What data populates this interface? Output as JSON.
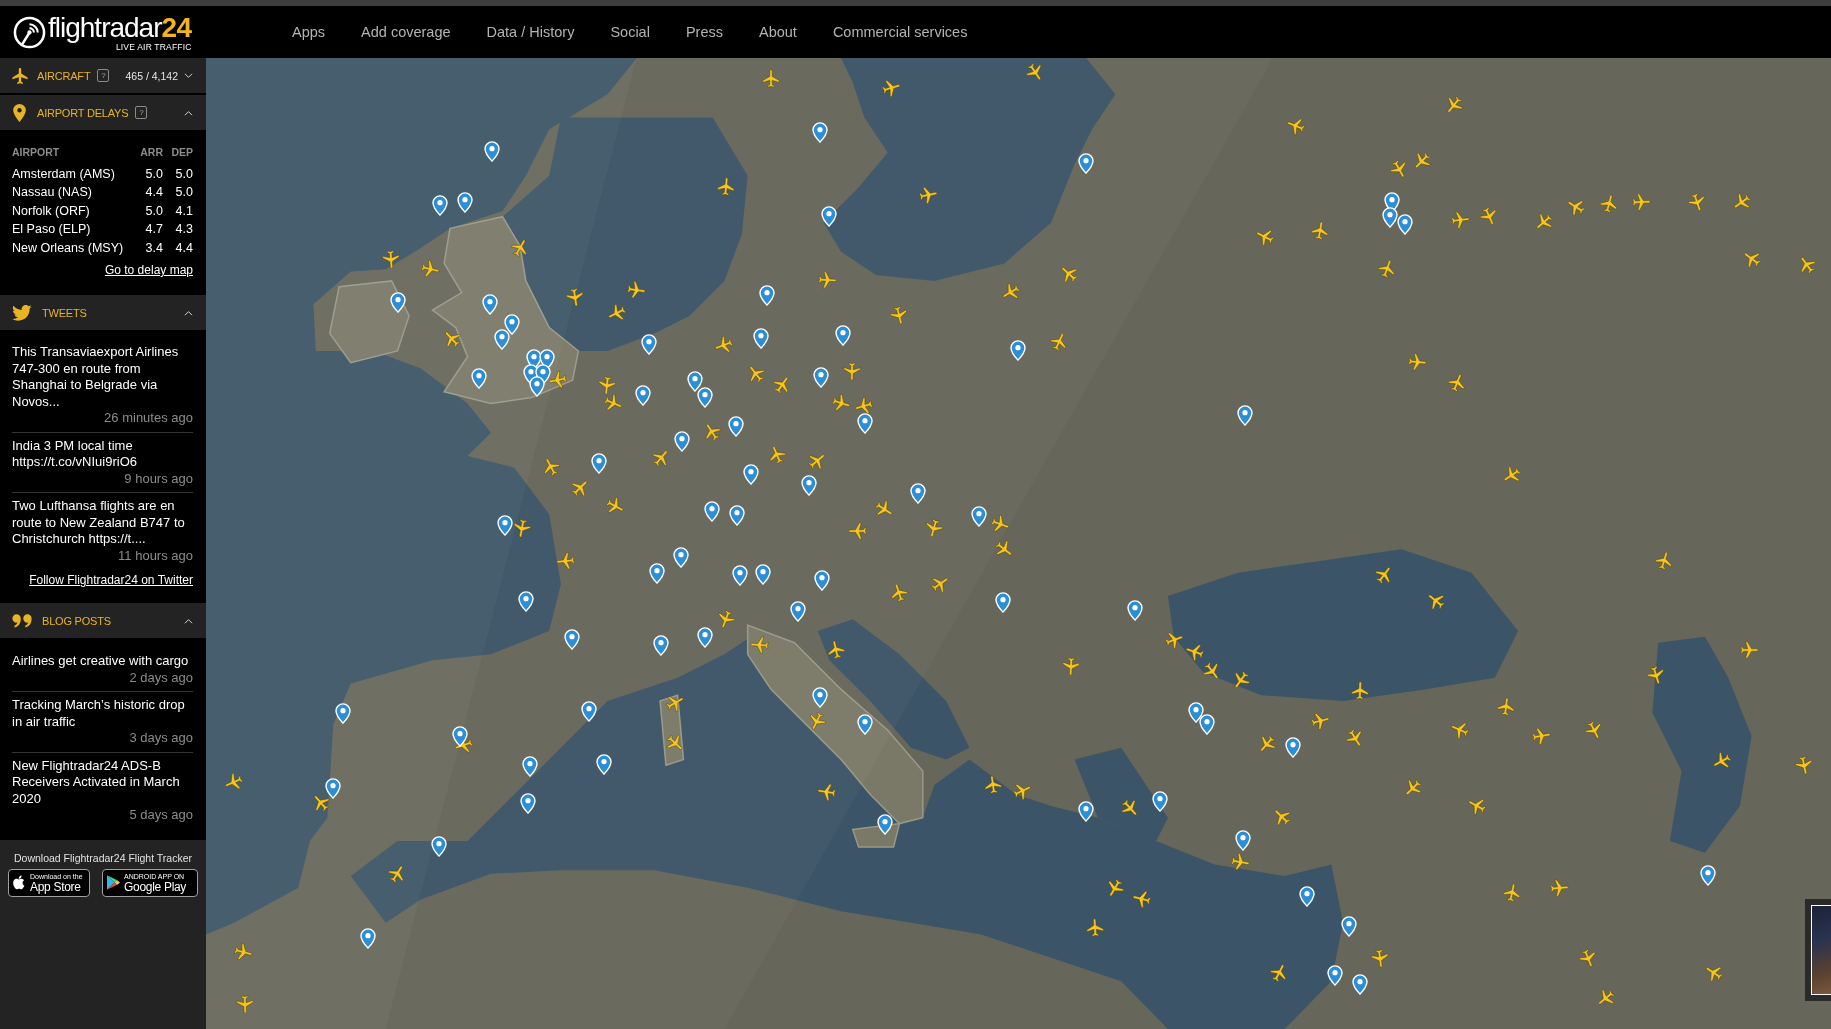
{
  "header": {
    "logo": {
      "name": "flightradar",
      "number": "24",
      "tagline": "LIVE AIR TRAFFIC"
    },
    "nav": [
      "Apps",
      "Add coverage",
      "Data / History",
      "Social",
      "Press",
      "About",
      "Commercial services"
    ]
  },
  "sidebar": {
    "aircraft": {
      "label": "AIRCRAFT",
      "help": "?",
      "count": "465 / 4,142",
      "expanded": false
    },
    "airport_delays": {
      "label": "AIRPORT DELAYS",
      "help": "?",
      "expanded": true,
      "columns": [
        "AIRPORT",
        "ARR",
        "DEP"
      ],
      "rows": [
        {
          "airport": "Amsterdam (AMS)",
          "arr": "5.0",
          "dep": "5.0"
        },
        {
          "airport": "Nassau (NAS)",
          "arr": "4.4",
          "dep": "5.0"
        },
        {
          "airport": "Norfolk (ORF)",
          "arr": "5.0",
          "dep": "4.1"
        },
        {
          "airport": "El Paso (ELP)",
          "arr": "4.7",
          "dep": "4.3"
        },
        {
          "airport": "New Orleans (MSY)",
          "arr": "3.4",
          "dep": "4.4"
        }
      ],
      "link": "Go to delay map"
    },
    "tweets": {
      "label": "TWEETS",
      "expanded": true,
      "items": [
        {
          "text": "This Transaviaexport Airlines 747-300 en route from Shanghai to Belgrade via Novos...",
          "time": "26 minutes ago"
        },
        {
          "text": "India 3 PM local time https://t.co/vNIui9riO6",
          "time": "9 hours ago"
        },
        {
          "text": "Two Lufthansa flights are en route to New Zealand B747 to Christchurch https://t....",
          "time": "11 hours ago"
        }
      ],
      "link": "Follow Flightradar24 on Twitter"
    },
    "blog_posts": {
      "label": "BLOG POSTS",
      "expanded": true,
      "items": [
        {
          "title": "Airlines get creative with cargo",
          "time": "2 days ago"
        },
        {
          "title": "Tracking March’s historic drop in air traffic",
          "time": "3 days ago"
        },
        {
          "title": "New Flightradar24 ADS-B Receivers Activated in March 2020",
          "time": "5 days ago"
        }
      ]
    },
    "download": {
      "title": "Download Flightradar24 Flight Tracker",
      "badges": [
        {
          "kind": "app_store",
          "small": "Download on the",
          "big": "App Store"
        },
        {
          "kind": "google_play",
          "small": "ANDROID APP ON",
          "big": "Google Play"
        }
      ]
    }
  }
}
